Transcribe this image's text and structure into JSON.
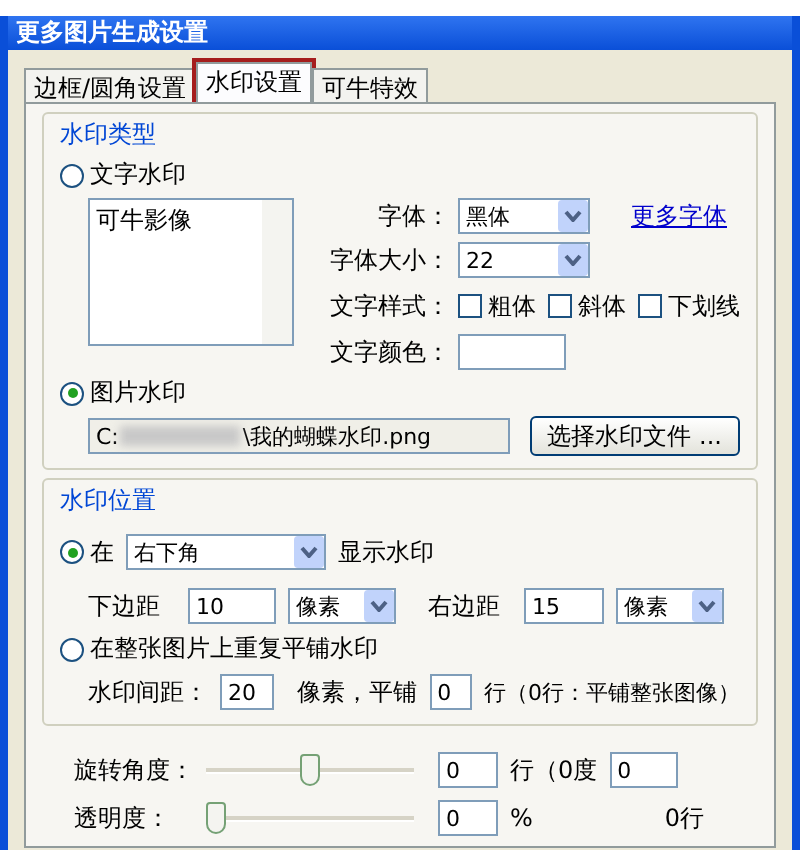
{
  "window": {
    "title": "更多图片生成设置"
  },
  "tabs": [
    {
      "label": "边框/圆角设置",
      "selected": false
    },
    {
      "label": "水印设置",
      "selected": true
    },
    {
      "label": "可牛特效",
      "selected": false
    }
  ],
  "watermark_type": {
    "title": "水印类型",
    "text_option": {
      "label": "文字水印",
      "selected": false
    },
    "text_value": "可牛影像",
    "font": {
      "label": "字体：",
      "value": "黑体"
    },
    "more_fonts": "更多字体",
    "font_size": {
      "label": "字体大小：",
      "value": "22"
    },
    "style": {
      "label": "文字样式：",
      "options": [
        {
          "label": "粗体",
          "checked": false
        },
        {
          "label": "斜体",
          "checked": false
        },
        {
          "label": "下划线",
          "checked": false
        }
      ]
    },
    "color": {
      "label": "文字颜色：",
      "color": "#ffffff"
    },
    "image_option": {
      "label": "图片水印",
      "selected": true
    },
    "path_prefix": "C:",
    "path_suffix": "\\我的蝴蝶水印.png",
    "choose_button": "选择水印文件 ..."
  },
  "watermark_position": {
    "title": "水印位置",
    "corner_option": {
      "label": "在",
      "selected": true
    },
    "corner": "右下角",
    "corner_suffix": "显示水印",
    "bottom_margin": {
      "label": "下边距",
      "value": "10",
      "unit": "像素"
    },
    "right_margin": {
      "label": "右边距",
      "value": "15",
      "unit": "像素"
    },
    "tile_option": {
      "label": "在整张图片上重复平铺水印",
      "selected": false
    },
    "spacing": {
      "label": "水印间距：",
      "value": "20",
      "unit": "像素，平铺",
      "rows": "0",
      "note": "行（0行：平铺整张图像）"
    }
  },
  "rotation": {
    "label": "旋转角度：",
    "level": 0.5,
    "value": "0",
    "note": "行（0度",
    "extra": "0"
  },
  "opacity": {
    "label": "透明度：",
    "level": 0,
    "value": "0",
    "unit": "%",
    "extra": "0行"
  }
}
